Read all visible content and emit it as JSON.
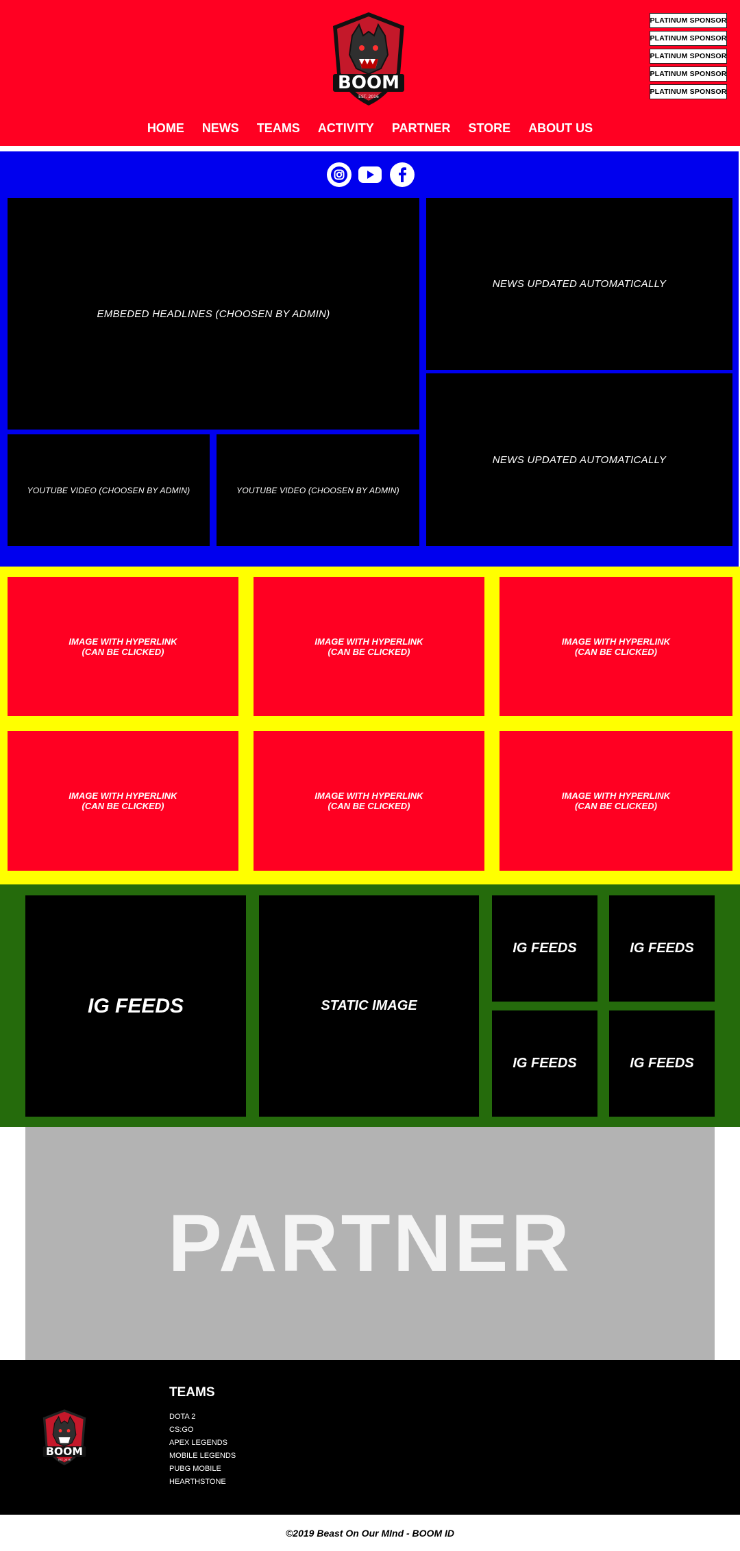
{
  "header": {
    "sponsors": [
      "PLATINUM SPONSOR",
      "PLATINUM SPONSOR",
      "PLATINUM SPONSOR",
      "PLATINUM SPONSOR",
      "PLATINUM SPONSOR"
    ],
    "nav": [
      "HOME",
      "NEWS",
      "TEAMS",
      "ACTIVITY",
      "PARTNER",
      "STORE",
      "ABOUT US"
    ],
    "logo_text": "BOOM",
    "logo_est": "EST. 2016"
  },
  "social": {
    "icons": [
      "instagram-icon",
      "youtube-icon",
      "facebook-icon"
    ]
  },
  "blue": {
    "headline": "EMBEDED HEADLINES (CHOOSEN BY ADMIN)",
    "news_1": "NEWS UPDATED AUTOMATICALLY",
    "news_2": "NEWS UPDATED AUTOMATICALLY",
    "youtube_1": "YOUTUBE VIDEO (CHOOSEN BY ADMIN)",
    "youtube_2": "YOUTUBE VIDEO (CHOOSEN BY ADMIN)"
  },
  "tiles": {
    "line1": "IMAGE WITH HYPERLINK",
    "line2": "(CAN BE CLICKED)"
  },
  "green": {
    "ig_big": "IG FEEDS",
    "static": "STATIC IMAGE",
    "ig_small": [
      "IG FEEDS",
      "IG FEEDS",
      "IG FEEDS",
      "IG FEEDS"
    ]
  },
  "partner": {
    "label": "PARTNER"
  },
  "footer": {
    "teams_title": "TEAMS",
    "teams": [
      "DOTA 2",
      "CS:GO",
      "APEX LEGENDS",
      "MOBILE LEGENDS",
      "PUBG MOBILE",
      "HEARTHSTONE"
    ],
    "copyright": "©2019 Beast On Our MInd - BOOM ID"
  },
  "colors": {
    "header_red": "#ff0022",
    "blue": "#0000ee",
    "yellow": "#ffff00",
    "green": "#256b0c",
    "partner_gray": "#b3b3b3"
  }
}
